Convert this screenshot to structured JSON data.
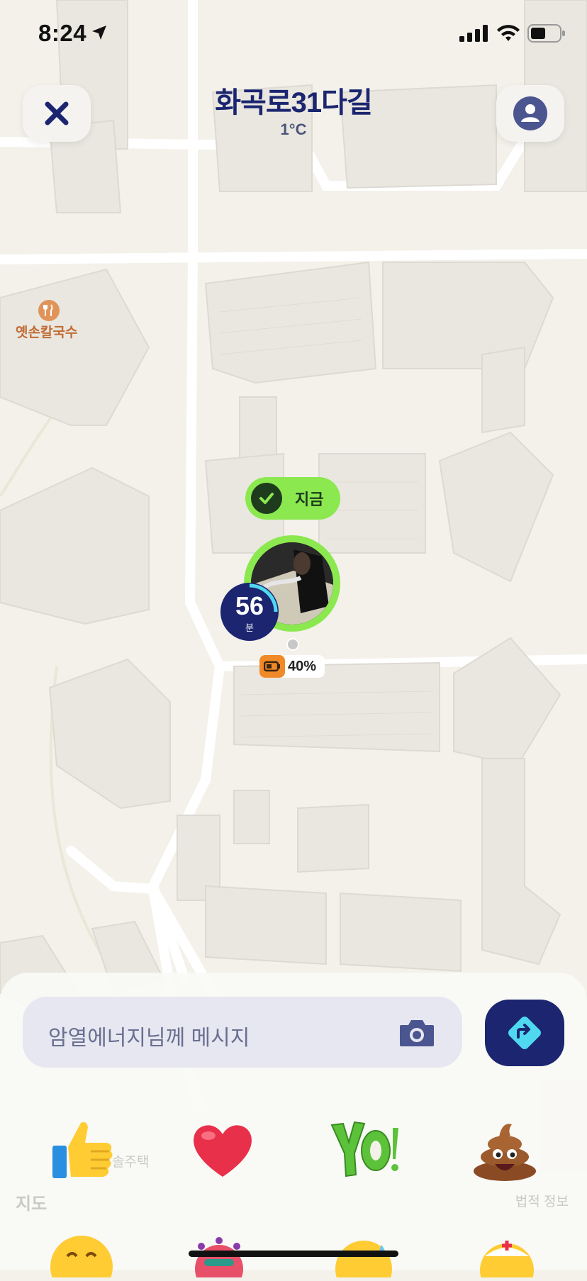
{
  "status_bar": {
    "time": "8:24"
  },
  "header": {
    "title": "화곡로31다길",
    "temperature": "1°C"
  },
  "map": {
    "poi_name": "옛손칼국수",
    "nearby_label": "솔주택",
    "attribution_left": "지도",
    "attribution_right": "법적 정보"
  },
  "friend_pin": {
    "status_label": "지금",
    "minutes": "56",
    "minutes_unit": "분",
    "battery": "40%",
    "pin_color": "#8be84f",
    "timer_color": "#1b2570",
    "battery_color": "#f08a28"
  },
  "message_bar": {
    "placeholder": "암열에너지님께 메시지"
  },
  "reactions": [
    "thumbs-up-icon",
    "heart-icon",
    "yo-sticker-icon",
    "poop-icon"
  ],
  "colors": {
    "brand_navy": "#1b2570",
    "accent_green": "#8be84f"
  }
}
